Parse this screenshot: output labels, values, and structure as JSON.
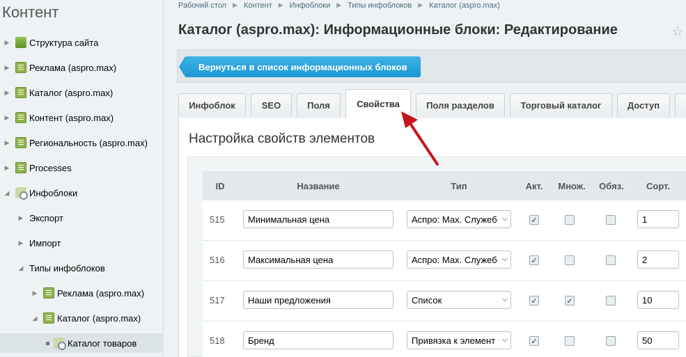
{
  "sidebar": {
    "title": "Контент",
    "items": [
      {
        "label": "Структура сайта",
        "icon": "site-structure-icon",
        "expanded": false
      },
      {
        "label": "Реклама (aspro.max)",
        "icon": "infoblock-icon",
        "expanded": false
      },
      {
        "label": "Каталог (aspro.max)",
        "icon": "infoblock-icon",
        "expanded": false
      },
      {
        "label": "Контент (aspro.max)",
        "icon": "infoblock-icon",
        "expanded": false
      },
      {
        "label": "Региональность (aspro.max)",
        "icon": "infoblock-icon",
        "expanded": false
      },
      {
        "label": "Processes",
        "icon": "infoblock-icon",
        "expanded": false
      },
      {
        "label": "Инфоблоки",
        "icon": "infoblock-settings-icon",
        "expanded": true
      },
      {
        "label": "Экспорт"
      },
      {
        "label": "Импорт"
      },
      {
        "label": "Типы инфоблоков"
      },
      {
        "label": "Реклама (aspro.max)"
      },
      {
        "label": "Каталог (aspro.max)"
      },
      {
        "label": "Каталог товаров"
      }
    ]
  },
  "breadcrumbs": [
    "Рабочий стол",
    "Контент",
    "Инфоблоки",
    "Типы инфоблоков",
    "Каталог (aspro.max)"
  ],
  "page_title": "Каталог (aspro.max): Информационные блоки: Редактирование",
  "back_button": "Вернуться в список информационных блоков",
  "tabs": [
    "Инфоблок",
    "SEO",
    "Поля",
    "Свойства",
    "Поля разделов",
    "Торговый каталог",
    "Доступ"
  ],
  "active_tab": "Свойства",
  "panel_title": "Настройка свойств элементов",
  "table": {
    "headers": {
      "id": "ID",
      "name": "Название",
      "type": "Тип",
      "active": "Акт.",
      "multiple": "Множ.",
      "required": "Обяз.",
      "sort": "Сорт."
    },
    "rows": [
      {
        "id": "515",
        "name": "Минимальная цена",
        "type": "Аспро: Мах. Служеб",
        "active": true,
        "multiple": false,
        "required": false,
        "sort": "1"
      },
      {
        "id": "516",
        "name": "Максимальная цена",
        "type": "Аспро: Мах. Служеб",
        "active": true,
        "multiple": false,
        "required": false,
        "sort": "2"
      },
      {
        "id": "517",
        "name": "Наши предложения",
        "type": "Список",
        "active": true,
        "multiple": true,
        "required": false,
        "sort": "10"
      },
      {
        "id": "518",
        "name": "Бренд",
        "type": "Привязка к элемент",
        "active": true,
        "multiple": false,
        "required": false,
        "sort": "50"
      }
    ]
  },
  "colors": {
    "accent": "#1c97d0",
    "annotation_arrow": "#c4161c"
  }
}
